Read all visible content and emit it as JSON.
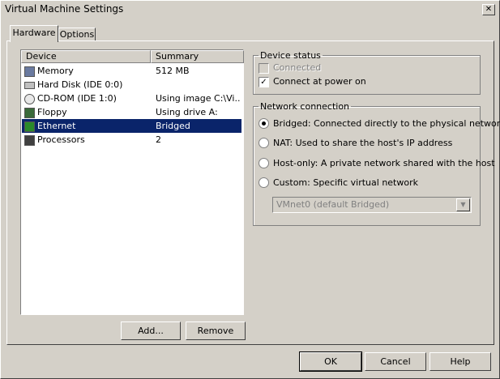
{
  "window": {
    "title": "Virtual Machine Settings",
    "close_glyph": "✕"
  },
  "tabs": [
    {
      "label": "Hardware"
    },
    {
      "label": "Options"
    }
  ],
  "device_list": {
    "headers": {
      "device": "Device",
      "summary": "Summary"
    },
    "rows": [
      {
        "device": "Memory",
        "summary": "512 MB",
        "icon": "memory-icon"
      },
      {
        "device": "Hard Disk (IDE 0:0)",
        "summary": "",
        "icon": "hard-disk-icon"
      },
      {
        "device": "CD-ROM (IDE 1:0)",
        "summary": "Using image C:\\Vi...",
        "icon": "cdrom-icon"
      },
      {
        "device": "Floppy",
        "summary": "Using drive A:",
        "icon": "floppy-icon"
      },
      {
        "device": "Ethernet",
        "summary": "Bridged",
        "icon": "ethernet-icon",
        "selected": true
      },
      {
        "device": "Processors",
        "summary": "2",
        "icon": "processor-icon"
      }
    ]
  },
  "list_buttons": {
    "add": "Add...",
    "remove": "Remove"
  },
  "device_status": {
    "legend": "Device status",
    "connected": {
      "label": "Connected",
      "checked": false,
      "disabled": true
    },
    "connect_at_power_on": {
      "label": "Connect at power on",
      "checked": true
    }
  },
  "network_connection": {
    "legend": "Network connection",
    "options": [
      {
        "label": "Bridged: Connected directly to the physical network",
        "selected": true
      },
      {
        "label": "NAT: Used to share the host's IP address",
        "selected": false
      },
      {
        "label": "Host-only: A private network shared with the host",
        "selected": false
      },
      {
        "label": "Custom: Specific virtual network",
        "selected": false
      }
    ],
    "custom_select": {
      "value": "VMnet0 (default Bridged)"
    }
  },
  "footer": {
    "ok": "OK",
    "cancel": "Cancel",
    "help": "Help"
  },
  "colors": {
    "face": "#d4d0c8",
    "selection": "#0a246a"
  }
}
